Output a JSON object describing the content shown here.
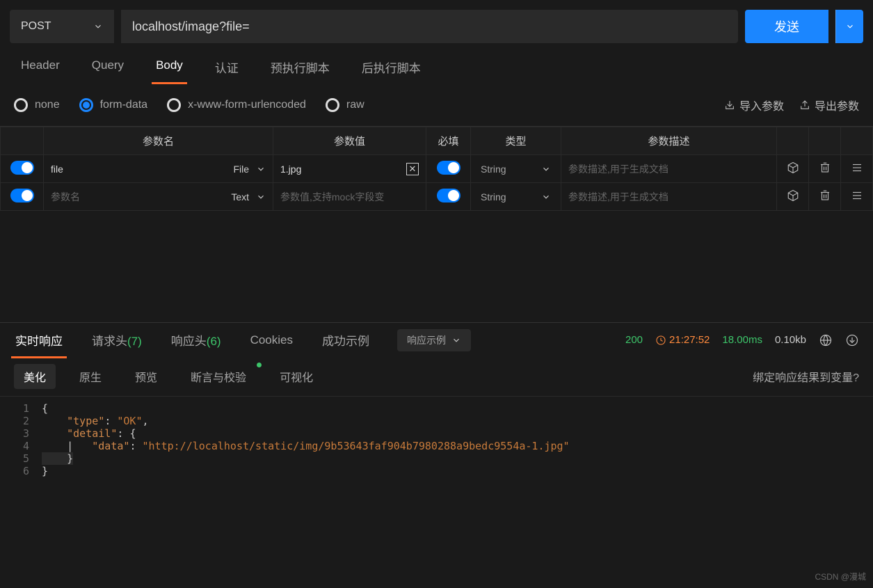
{
  "request": {
    "method": "POST",
    "url": "localhost/image?file=",
    "sendLabel": "发送"
  },
  "tabs": [
    "Header",
    "Query",
    "Body",
    "认证",
    "预执行脚本",
    "后执行脚本"
  ],
  "activeTab": "Body",
  "bodyTypes": {
    "options": [
      "none",
      "form-data",
      "x-www-form-urlencoded",
      "raw"
    ],
    "selected": "form-data"
  },
  "bodyActions": {
    "import": "导入参数",
    "export": "导出参数"
  },
  "paramsHeader": {
    "name": "参数名",
    "value": "参数值",
    "required": "必填",
    "type": "类型",
    "desc": "参数描述"
  },
  "params": [
    {
      "enabled": true,
      "name": "file",
      "kind": "File",
      "value": "1.jpg",
      "required": true,
      "type": "String",
      "descPlaceholder": "参数描述,用于生成文档"
    },
    {
      "enabled": true,
      "namePlaceholder": "参数名",
      "kind": "Text",
      "valuePlaceholder": "参数值,支持mock字段变",
      "required": true,
      "type": "String",
      "descPlaceholder": "参数描述,用于生成文档"
    }
  ],
  "response": {
    "tabs": {
      "live": "实时响应",
      "reqHeaders": "请求头",
      "reqHeadersCount": "(7)",
      "resHeaders": "响应头",
      "resHeadersCount": "(6)",
      "cookies": "Cookies",
      "successExample": "成功示例",
      "exampleSelector": "响应示例"
    },
    "status": "200",
    "time": "21:27:52",
    "duration": "18.00ms",
    "size": "0.10kb",
    "views": [
      "美化",
      "原生",
      "预览",
      "断言与校验",
      "可视化"
    ],
    "activeView": "美化",
    "bindLabel": "绑定响应结果到变量?",
    "body": {
      "type": "OK",
      "detail": {
        "data": "http://localhost/static/img/9b53643faf904b7980288a9bedc9554a-1.jpg"
      }
    }
  },
  "watermark": "CSDN @漫城"
}
